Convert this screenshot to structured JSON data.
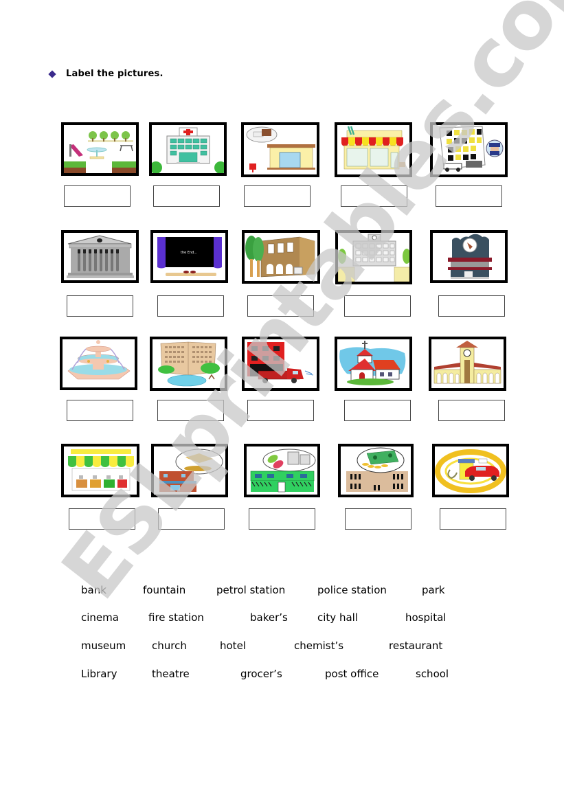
{
  "instruction": "Label the pictures.",
  "pictures": [
    {
      "depicts": "park"
    },
    {
      "depicts": "hospital"
    },
    {
      "depicts": "post office"
    },
    {
      "depicts": "baker's"
    },
    {
      "depicts": "police station"
    },
    {
      "depicts": "museum"
    },
    {
      "depicts": "cinema"
    },
    {
      "depicts": "library"
    },
    {
      "depicts": "school"
    },
    {
      "depicts": "restaurant"
    },
    {
      "depicts": "fountain"
    },
    {
      "depicts": "hotel"
    },
    {
      "depicts": "fire station"
    },
    {
      "depicts": "church"
    },
    {
      "depicts": "city hall"
    },
    {
      "depicts": "grocer's"
    },
    {
      "depicts": "theatre"
    },
    {
      "depicts": "chemist's"
    },
    {
      "depicts": "bank"
    },
    {
      "depicts": "petrol station"
    }
  ],
  "answer_boxes": [
    "",
    "",
    "",
    "",
    "",
    "",
    "",
    "",
    "",
    "",
    "",
    "",
    "",
    "",
    "",
    "",
    "",
    "",
    "",
    ""
  ],
  "word_bank": [
    [
      "bank",
      "fountain",
      "petrol station",
      "police station",
      "park"
    ],
    [
      "cinema",
      "fire station",
      "baker’s",
      "city hall",
      "hospital"
    ],
    [
      "museum",
      "church",
      "hotel",
      "chemist’s",
      "restaurant"
    ],
    [
      "Library",
      "theatre",
      "grocer’s",
      "post office",
      "school"
    ]
  ],
  "cinema_screen_text": "the End...",
  "watermark": "ESLprintables.com",
  "colors": {
    "bullet": "#3a2a8c",
    "frame": "#000000",
    "watermark": "#c8c8c8"
  }
}
